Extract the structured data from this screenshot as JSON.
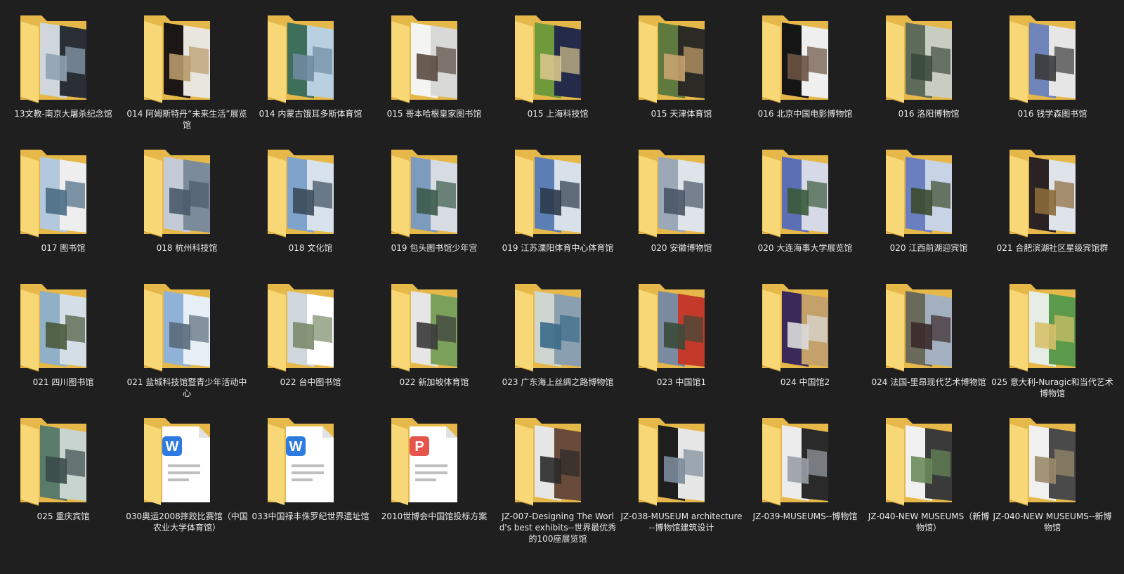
{
  "items": [
    {
      "label": "13文教-南京大屠杀纪念馆",
      "type": "folder",
      "palette": [
        "#cfd6dc",
        "#2a2f36",
        "#8fa3b3"
      ]
    },
    {
      "label": "014  阿姆斯特丹“未来生活”展览馆",
      "type": "folder",
      "palette": [
        "#1c1714",
        "#e9e6e0",
        "#b89a6a"
      ]
    },
    {
      "label": "014  内蒙古饿耳多斯体育馆",
      "type": "folder",
      "palette": [
        "#3d6f5a",
        "#b9d0e0",
        "#6e8a9e"
      ]
    },
    {
      "label": "015  哥本哈根皇家图书馆",
      "type": "folder",
      "palette": [
        "#f4f4f2",
        "#d8d8d6",
        "#5a4a40"
      ]
    },
    {
      "label": "015  上海科技馆",
      "type": "folder",
      "palette": [
        "#6f9a3c",
        "#232a4a",
        "#d7c48a"
      ]
    },
    {
      "label": "015  天津体育馆",
      "type": "folder",
      "palette": [
        "#5e7a3e",
        "#2b2a24",
        "#c7a36e"
      ]
    },
    {
      "label": "016  北京中国电影博物馆",
      "type": "folder",
      "palette": [
        "#151515",
        "#efefef",
        "#6a5242"
      ]
    },
    {
      "label": "016  洛阳博物馆",
      "type": "folder",
      "palette": [
        "#5e6a5a",
        "#c8cdc2",
        "#3a4a3a"
      ]
    },
    {
      "label": "016  钱学森图书馆",
      "type": "folder",
      "palette": [
        "#6f84b8",
        "#e6e6e6",
        "#3a3a3a"
      ]
    },
    {
      "label": "017  图书馆",
      "type": "folder",
      "palette": [
        "#b3c8dc",
        "#eeeeee",
        "#4a6b84"
      ]
    },
    {
      "label": "018  杭州科技馆",
      "type": "folder",
      "palette": [
        "#c3ccd6",
        "#7c8b9a",
        "#4a5a6a"
      ]
    },
    {
      "label": "018  文化馆",
      "type": "folder",
      "palette": [
        "#7fa3cb",
        "#d8e2ec",
        "#3b4b5b"
      ]
    },
    {
      "label": "019  包头图书馆少年宫",
      "type": "folder",
      "palette": [
        "#7d9bbd",
        "#d6dce2",
        "#3b5a4a"
      ]
    },
    {
      "label": "019  江苏溧阳体育中心体育馆",
      "type": "folder",
      "palette": [
        "#5b7fb5",
        "#d8e0ea",
        "#2b3a4a"
      ]
    },
    {
      "label": "020  安徽博物馆",
      "type": "folder",
      "palette": [
        "#9aa8b8",
        "#dfe4ea",
        "#4a5566"
      ]
    },
    {
      "label": "020  大连海事大学展览馆",
      "type": "folder",
      "palette": [
        "#5c6fb4",
        "#d6d9e6",
        "#3a5a3a"
      ]
    },
    {
      "label": "020  江西前湖迎宾馆",
      "type": "folder",
      "palette": [
        "#6a7fc0",
        "#c9d3e6",
        "#3b4a2b"
      ]
    },
    {
      "label": "021  合肥滨湖社区星级宾馆群",
      "type": "folder",
      "palette": [
        "#2b2323",
        "#dfe3ea",
        "#8a6a3a"
      ]
    },
    {
      "label": "021  四川图书馆",
      "type": "folder",
      "palette": [
        "#8fb0c6",
        "#d4dee6",
        "#4a5a3a"
      ]
    },
    {
      "label": "021  盐城科技馆暨青少年活动中心",
      "type": "folder",
      "palette": [
        "#8fb2d6",
        "#e6eef6",
        "#5a6a7a"
      ]
    },
    {
      "label": "022  台中图书馆",
      "type": "folder",
      "palette": [
        "#cfd6dc",
        "#ffffff",
        "#7a8a6a"
      ]
    },
    {
      "label": "022  新加坡体育馆",
      "type": "folder",
      "palette": [
        "#e6e6e6",
        "#7aa05a",
        "#3a3a3a"
      ]
    },
    {
      "label": "023  广东海上丝绸之路博物馆",
      "type": "folder",
      "palette": [
        "#cfd6d0",
        "#8aa0b0",
        "#3a6a8a"
      ]
    },
    {
      "label": "023  中国馆1",
      "type": "folder",
      "palette": [
        "#7a8aa0",
        "#c43a2a",
        "#3a4a3a"
      ]
    },
    {
      "label": "024  中国馆2",
      "type": "folder",
      "palette": [
        "#3a2a5a",
        "#c4a06a",
        "#dcdcdc"
      ]
    },
    {
      "label": "024  法国-里昂现代艺术博物馆",
      "type": "folder",
      "palette": [
        "#6a6a5a",
        "#a3b0c0",
        "#3a2a2a"
      ]
    },
    {
      "label": "025  意大利-Nuragic和当代艺术博物馆",
      "type": "folder",
      "palette": [
        "#e6ede6",
        "#5a9a4a",
        "#d6c06a"
      ]
    },
    {
      "label": "025  重庆宾馆",
      "type": "folder",
      "palette": [
        "#5a7a6a",
        "#c8d4d0",
        "#3a4a4a"
      ]
    },
    {
      "label": "030奥运2008摔跤比赛馆（中国农业大学体育馆）",
      "type": "word",
      "palette": [
        "#ffffff",
        "#2d7be0",
        "#bfbfbf"
      ]
    },
    {
      "label": "033中国禄丰侏罗纪世界遗址馆",
      "type": "word",
      "palette": [
        "#ffffff",
        "#2d7be0",
        "#bfbfbf"
      ]
    },
    {
      "label": "2010世博会中国馆投标方案",
      "type": "pdf",
      "palette": [
        "#ffffff",
        "#e5534b",
        "#bfbfbf"
      ]
    },
    {
      "label": "JZ-007-Designing The World's best exhibits--世界最优秀的100座展览馆",
      "type": "folder",
      "palette": [
        "#e6e6e6",
        "#6a4a3a",
        "#2a2a2a"
      ]
    },
    {
      "label": "JZ-038-MUSEUM architecture--博物馆建筑设计",
      "type": "folder",
      "palette": [
        "#1e1e1e",
        "#e6e6e6",
        "#7a8a9a"
      ]
    },
    {
      "label": "JZ-039-MUSEUMS--博物馆",
      "type": "folder",
      "palette": [
        "#ececec",
        "#2a2a2a",
        "#9aa0a6"
      ]
    },
    {
      "label": "JZ-040-NEW MUSEUMS（新博物馆）",
      "type": "folder",
      "palette": [
        "#f0f0f0",
        "#3a3a3a",
        "#6a8a5a"
      ]
    },
    {
      "label": "JZ-040-NEW MUSEUMS--新博物馆",
      "type": "folder",
      "palette": [
        "#f0f0f0",
        "#4a4a4a",
        "#9a8a6a"
      ]
    }
  ],
  "icons": {
    "folder_back": "#e6b84a",
    "folder_front": "#f8d776",
    "folder_shadow": "#c9972c"
  }
}
